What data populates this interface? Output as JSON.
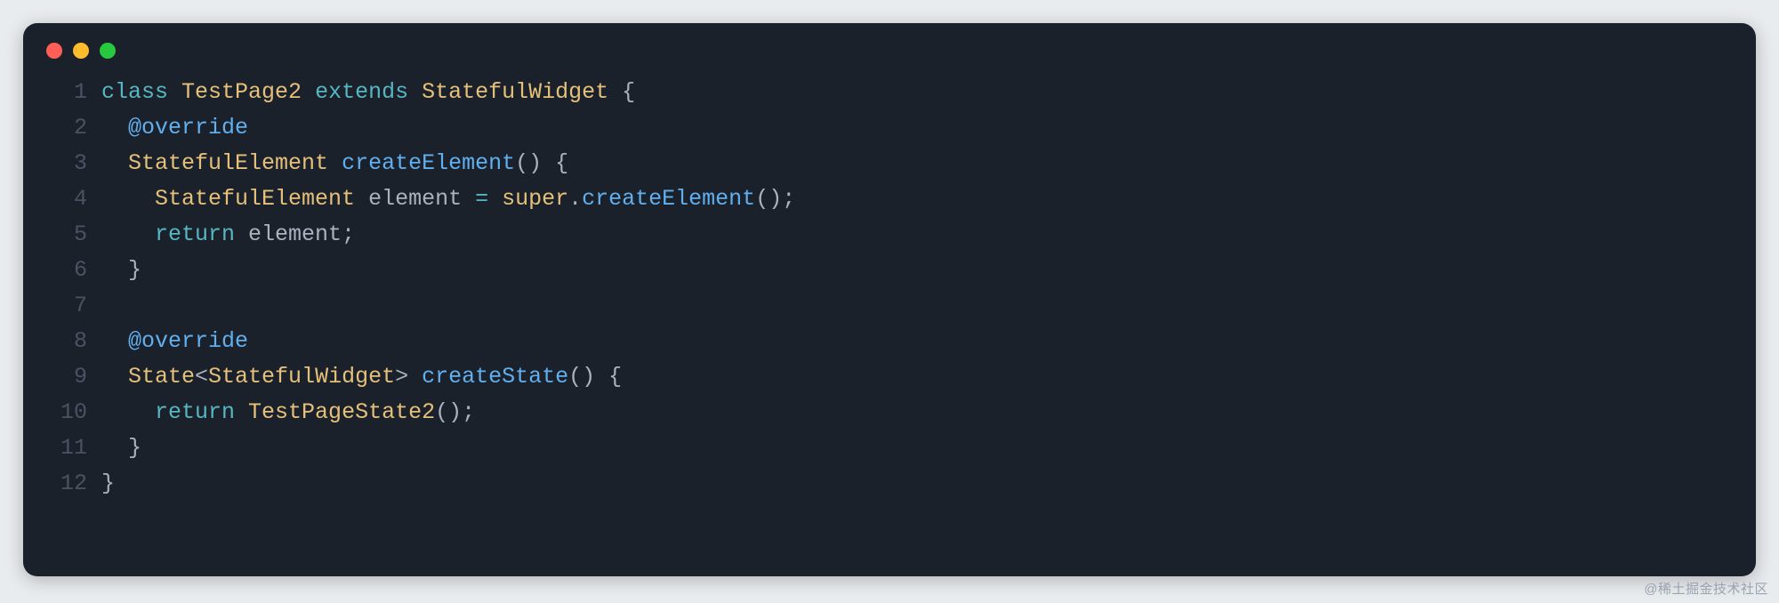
{
  "traffic_lights": {
    "red": "close-icon",
    "yellow": "minimize-icon",
    "green": "zoom-icon"
  },
  "watermark": "@稀土掘金技术社区",
  "code": {
    "lines": [
      {
        "n": "1",
        "segs": [
          {
            "c": "tk-cyan",
            "t": "class"
          },
          {
            "c": "tk-text",
            "t": " "
          },
          {
            "c": "tk-key",
            "t": "TestPage2"
          },
          {
            "c": "tk-text",
            "t": " "
          },
          {
            "c": "tk-cyan",
            "t": "extends"
          },
          {
            "c": "tk-text",
            "t": " "
          },
          {
            "c": "tk-key",
            "t": "StatefulWidget"
          },
          {
            "c": "tk-text",
            "t": " {"
          }
        ]
      },
      {
        "n": "2",
        "segs": [
          {
            "c": "tk-text",
            "t": "  "
          },
          {
            "c": "tk-fn",
            "t": "@override"
          }
        ]
      },
      {
        "n": "3",
        "segs": [
          {
            "c": "tk-text",
            "t": "  "
          },
          {
            "c": "tk-key",
            "t": "StatefulElement"
          },
          {
            "c": "tk-text",
            "t": " "
          },
          {
            "c": "tk-fn",
            "t": "createElement"
          },
          {
            "c": "tk-text",
            "t": "() {"
          }
        ]
      },
      {
        "n": "4",
        "segs": [
          {
            "c": "tk-text",
            "t": "    "
          },
          {
            "c": "tk-key",
            "t": "StatefulElement"
          },
          {
            "c": "tk-text",
            "t": " element "
          },
          {
            "c": "tk-cyan",
            "t": "="
          },
          {
            "c": "tk-text",
            "t": " "
          },
          {
            "c": "tk-key",
            "t": "super"
          },
          {
            "c": "tk-text",
            "t": "."
          },
          {
            "c": "tk-fn",
            "t": "createElement"
          },
          {
            "c": "tk-text",
            "t": "();"
          }
        ]
      },
      {
        "n": "5",
        "segs": [
          {
            "c": "tk-text",
            "t": "    "
          },
          {
            "c": "tk-cyan",
            "t": "return"
          },
          {
            "c": "tk-text",
            "t": " element;"
          }
        ]
      },
      {
        "n": "6",
        "segs": [
          {
            "c": "tk-text",
            "t": "  }"
          }
        ]
      },
      {
        "n": "7",
        "segs": [
          {
            "c": "tk-text",
            "t": ""
          }
        ]
      },
      {
        "n": "8",
        "segs": [
          {
            "c": "tk-text",
            "t": "  "
          },
          {
            "c": "tk-fn",
            "t": "@override"
          }
        ]
      },
      {
        "n": "9",
        "segs": [
          {
            "c": "tk-text",
            "t": "  "
          },
          {
            "c": "tk-key",
            "t": "State"
          },
          {
            "c": "tk-text",
            "t": "<"
          },
          {
            "c": "tk-key",
            "t": "StatefulWidget"
          },
          {
            "c": "tk-text",
            "t": "> "
          },
          {
            "c": "tk-fn",
            "t": "createState"
          },
          {
            "c": "tk-text",
            "t": "() {"
          }
        ]
      },
      {
        "n": "10",
        "segs": [
          {
            "c": "tk-text",
            "t": "    "
          },
          {
            "c": "tk-cyan",
            "t": "return"
          },
          {
            "c": "tk-text",
            "t": " "
          },
          {
            "c": "tk-key",
            "t": "TestPageState2"
          },
          {
            "c": "tk-text",
            "t": "();"
          }
        ]
      },
      {
        "n": "11",
        "segs": [
          {
            "c": "tk-text",
            "t": "  }"
          }
        ]
      },
      {
        "n": "12",
        "segs": [
          {
            "c": "tk-text",
            "t": "}"
          }
        ]
      }
    ]
  }
}
